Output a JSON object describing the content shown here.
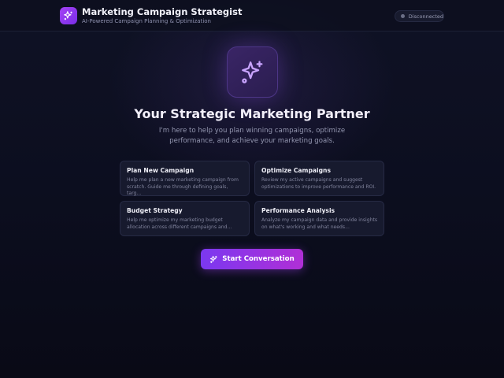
{
  "header": {
    "title": "Marketing Campaign Strategist",
    "subtitle": "AI-Powered Campaign Planning & Optimization",
    "brand_icon": "sparkles-icon",
    "status": {
      "label": "Disconnected",
      "dot_color": "#6b6f86"
    }
  },
  "hero": {
    "icon": "sparkles-icon",
    "title": "Your Strategic Marketing Partner",
    "subtitle": "I'm here to help you plan winning campaigns, optimize performance, and achieve your marketing goals."
  },
  "cards": [
    {
      "title": "Plan New Campaign",
      "description": "Help me plan a new marketing campaign from scratch. Guide me through defining goals, targ..."
    },
    {
      "title": "Optimize Campaigns",
      "description": "Review my active campaigns and suggest optimizations to improve performance and ROI."
    },
    {
      "title": "Budget Strategy",
      "description": "Help me optimize my marketing budget allocation across different campaigns and..."
    },
    {
      "title": "Performance Analysis",
      "description": "Analyze my campaign data and provide insights on what's working and what needs..."
    }
  ],
  "cta": {
    "label": "Start Conversation",
    "icon": "sparkles-icon"
  },
  "colors": {
    "accent_start": "#7b38f0",
    "accent_end": "#b02fd6",
    "background": "#0c0e1f"
  }
}
